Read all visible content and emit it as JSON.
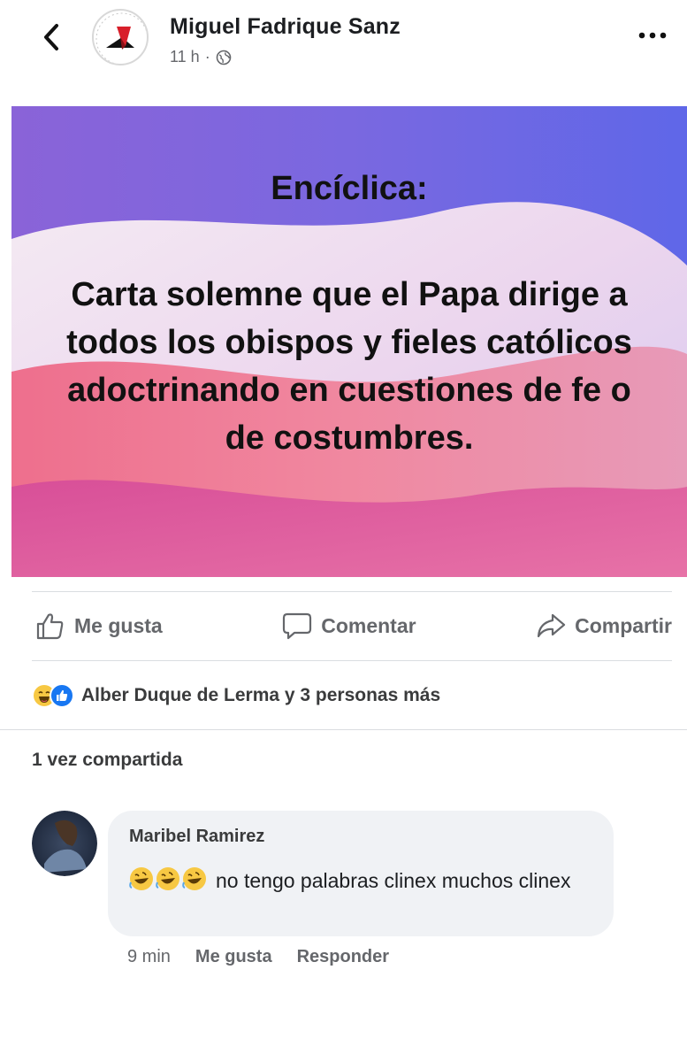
{
  "post": {
    "author": "Miguel Fadrique Sanz",
    "time": "11 h",
    "separator": "·",
    "image_title": "Encíclica:",
    "image_body": "Carta solemne que el Papa dirige a todos los obispos y fieles católicos adoctrinando en cuestiones de fe o de costumbres."
  },
  "actions": {
    "like": "Me gusta",
    "comment": "Comentar",
    "share": "Compartir"
  },
  "reactions": {
    "icons": [
      "laughing-emoji",
      "like-icon"
    ],
    "text": "Alber Duque de Lerma y 3 personas más"
  },
  "shares": "1 vez compartida",
  "comment": {
    "author": "Maribel Ramirez",
    "emoji": "🤣🤣🤣",
    "text": "no tengo palabras clinex muchos clinex",
    "time": "9 min",
    "like": "Me gusta",
    "reply": "Responder"
  },
  "colors": {
    "link_blue": "#1877f2",
    "muted_text": "#65676b",
    "bubble_bg": "#f0f2f5"
  }
}
